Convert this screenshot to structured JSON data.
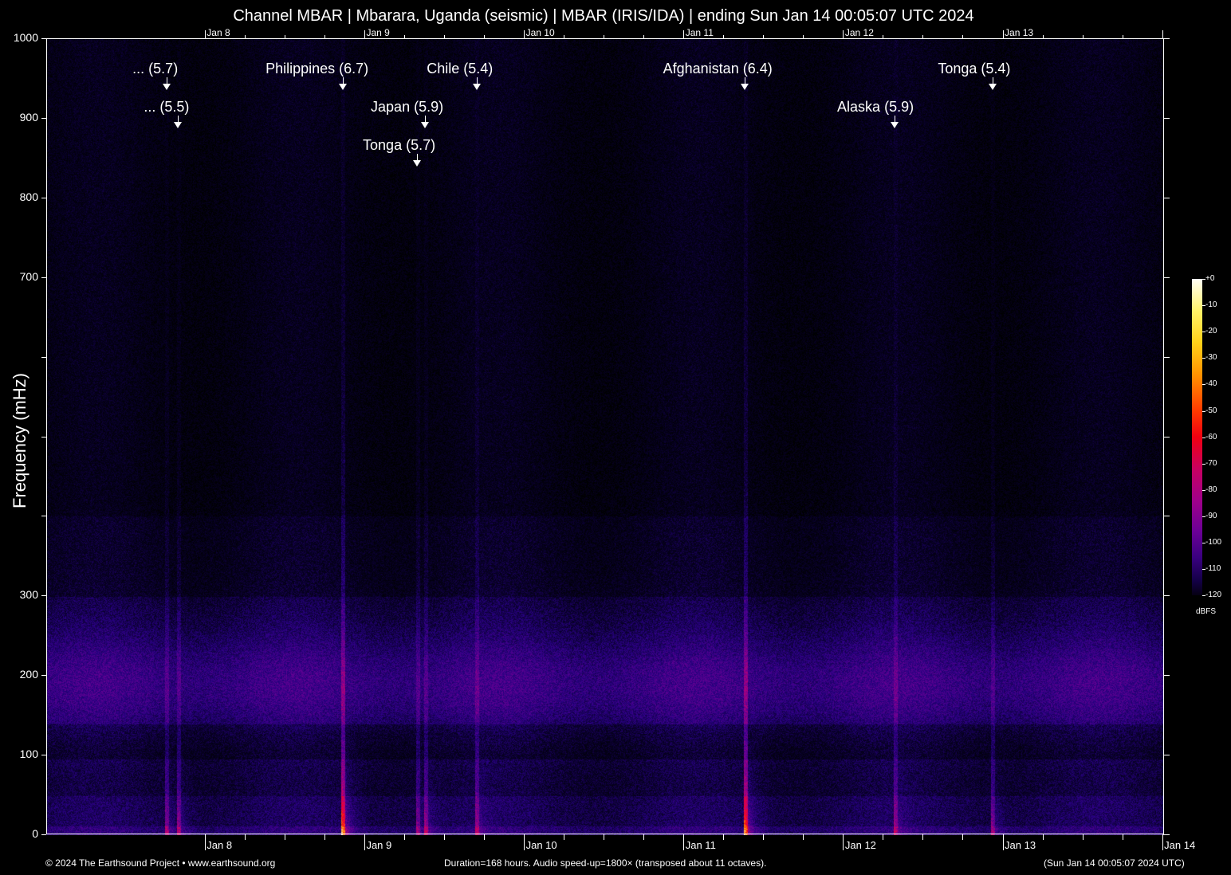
{
  "chart_data": {
    "type": "heatmap",
    "title": "Channel MBAR | Mbarara, Uganda (seismic) | MBAR (IRIS/IDA) | ending Sun Jan 14 00:05:07 UTC 2024",
    "ylabel": "Frequency (mHz)",
    "ylim": [
      0,
      1000
    ],
    "yticks": [
      0,
      100,
      200,
      300,
      400,
      500,
      600,
      700,
      800,
      900,
      1000
    ],
    "ytick_labels": [
      "0",
      "100",
      "200",
      "300",
      "",
      "",
      "",
      "700",
      "800",
      "900",
      "1000"
    ],
    "xlim_hours": [
      0,
      168
    ],
    "xtick_labels_bottom": [
      "Jan  8",
      "Jan  9",
      "Jan 10",
      "Jan 11",
      "Jan 12",
      "Jan 13",
      "Jan 14"
    ],
    "xtick_labels_top": [
      "Jan  8",
      "Jan  9",
      "Jan 10",
      "Jan 11",
      "Jan 12",
      "Jan 13"
    ],
    "colorbar": {
      "label": "dBFS",
      "range": [
        -120,
        0
      ],
      "ticks": [
        "+0",
        "-10",
        "-20",
        "-30",
        "-40",
        "-50",
        "-60",
        "-70",
        "-80",
        "-90",
        "-100",
        "-110",
        "-120"
      ]
    },
    "events": [
      {
        "label": "... (5.7)",
        "hour": 18.1,
        "row": 0
      },
      {
        "label": "... (5.5)",
        "hour": 19.8,
        "row": 1
      },
      {
        "label": "Philippines (6.7)",
        "hour": 44.6,
        "row": 0
      },
      {
        "label": "Chile (5.4)",
        "hour": 64.7,
        "row": 0
      },
      {
        "label": "Japan (5.9)",
        "hour": 57.0,
        "row": 1
      },
      {
        "label": "Tonga (5.7)",
        "hour": 55.8,
        "row": 2
      },
      {
        "label": "Afghanistan (6.4)",
        "hour": 105.1,
        "row": 0
      },
      {
        "label": "Alaska (5.9)",
        "hour": 127.6,
        "row": 1
      },
      {
        "label": "Tonga (5.4)",
        "hour": 142.3,
        "row": 0
      }
    ]
  },
  "footer": {
    "copyright": "© 2024 The Earthsound Project • www.earthsound.org",
    "info": "Duration=168 hours. Audio speed-up=1800× (transposed about 11 octaves).",
    "end_time": "(Sun Jan 14 00:05:07 2024 UTC)"
  }
}
